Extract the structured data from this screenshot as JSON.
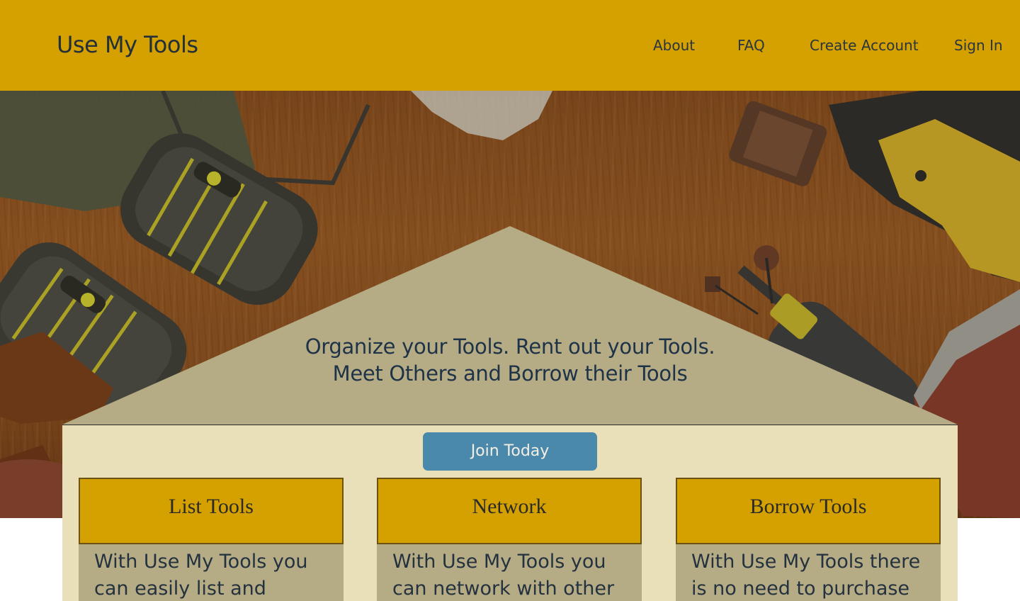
{
  "header": {
    "brand": "Use My Tools",
    "nav": [
      "About",
      "FAQ",
      "Create Account",
      "Sign In"
    ]
  },
  "hero": {
    "tagline_line1": "Organize your Tools. Rent out your Tools.",
    "tagline_line2": "Meet Others and Borrow their Tools",
    "join_label": "Join Today"
  },
  "features": [
    {
      "title": "List Tools",
      "text": "With Use My Tools you can easily list and"
    },
    {
      "title": "Network",
      "text": "With Use My Tools you can network with other"
    },
    {
      "title": "Borrow Tools",
      "text": "With Use My Tools there is no need to purchase a"
    }
  ],
  "colors": {
    "header": "#d4a100",
    "roof": "#b5ab85",
    "panel": "#e9e0b9",
    "button": "#4a88ac",
    "text": "#1e3347"
  }
}
